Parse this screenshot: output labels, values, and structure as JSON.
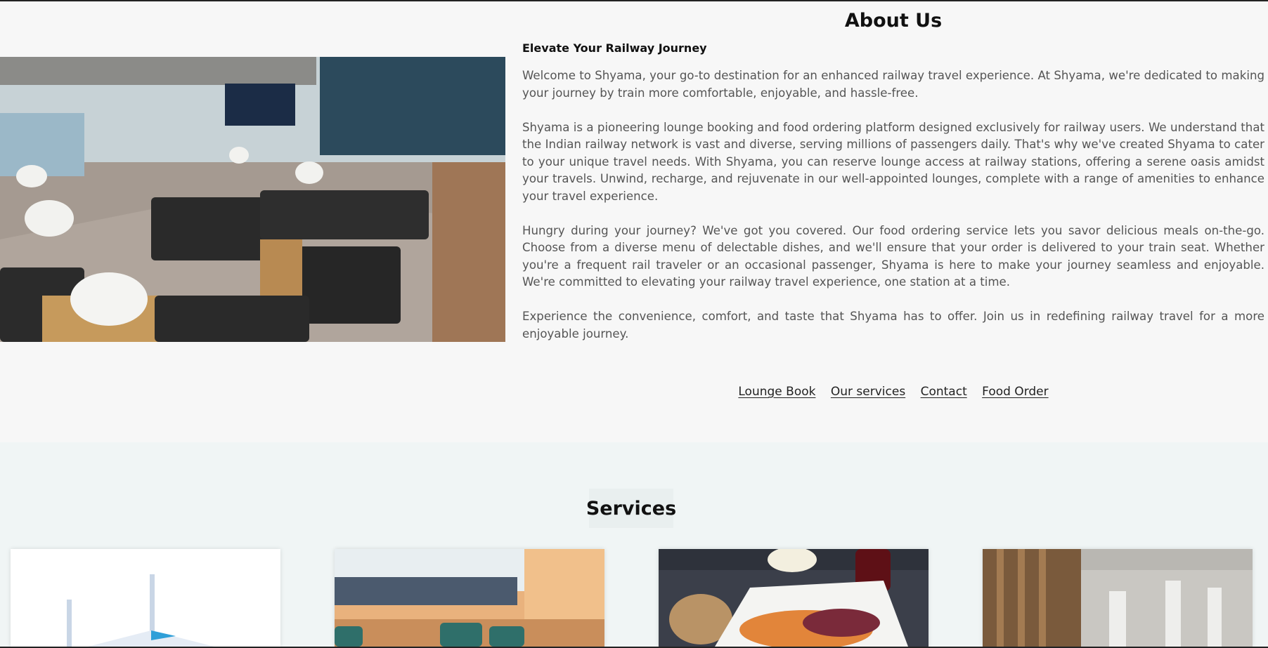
{
  "about": {
    "title": "About Us",
    "subtitle": "Elevate Your Railway Journey",
    "paragraphs": [
      "Welcome to Shyama, your go-to destination for an enhanced railway travel experience. At Shyama, we're dedicated to making your journey by train more comfortable, enjoyable, and hassle-free.",
      "Shyama is a pioneering lounge booking and food ordering platform designed exclusively for railway users. We understand that the Indian railway network is vast and diverse, serving millions of passengers daily. That's why we've created Shyama to cater to your unique travel needs. With Shyama, you can reserve lounge access at railway stations, offering a serene oasis amidst your travels. Unwind, recharge, and rejuvenate in our well-appointed lounges, complete with a range of amenities to enhance your travel experience.",
      "Hungry during your journey? We've got you covered. Our food ordering service lets you savor delicious meals on-the-go. Choose from a diverse menu of delectable dishes, and we'll ensure that your order is delivered to your train seat. Whether you're a frequent rail traveler or an occasional passenger, Shyama is here to make your journey seamless and enjoyable. We're committed to elevating your railway travel experience, one station at a time.",
      "Experience the convenience, comfort, and taste that Shyama has to offer. Join us in redefining railway travel for a more enjoyable journey."
    ],
    "links": [
      "Lounge Book",
      "Our services",
      "Contact",
      "Food Order"
    ]
  },
  "services": {
    "title": "Services"
  }
}
